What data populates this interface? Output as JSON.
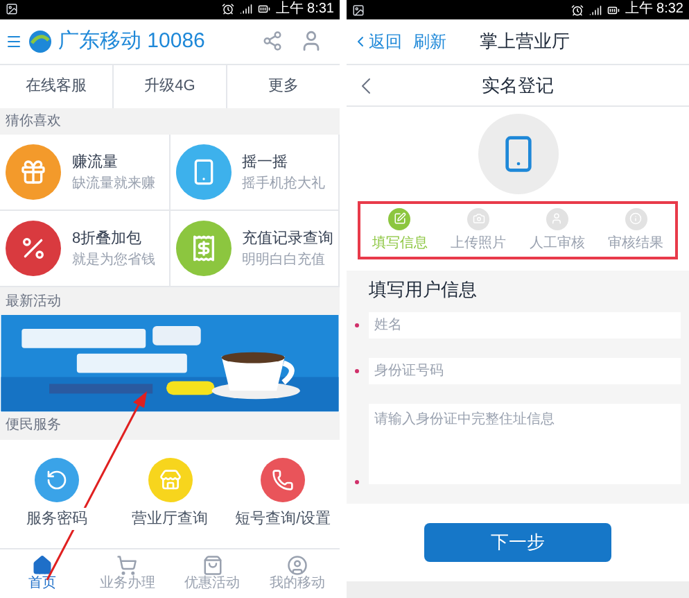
{
  "left": {
    "status_bar": {
      "time": "上午 8:31"
    },
    "app_title": "广东移动 10086",
    "quick_links": [
      "在线客服",
      "升级4G",
      "更多"
    ],
    "recommend": {
      "title": "猜你喜欢",
      "items": [
        {
          "kind": "gift",
          "title": "赚流量",
          "subtitle": "缺流量就来赚",
          "color": "#f39a2b"
        },
        {
          "kind": "shake",
          "title": "摇一摇",
          "subtitle": "摇手机抢大礼",
          "color": "#3db1ec"
        },
        {
          "kind": "discount",
          "title": "8折叠加包",
          "subtitle": "就是为您省钱",
          "color": "#d93a3f"
        },
        {
          "kind": "recharge",
          "title": "充值记录查询",
          "subtitle": "明明白白充值",
          "color": "#8cc63f"
        }
      ]
    },
    "activity": {
      "title": "最新活动"
    },
    "services": {
      "title": "便民服务",
      "items": [
        {
          "kind": "password",
          "label": "服务密码",
          "color": "#3aa3e8"
        },
        {
          "kind": "store",
          "label": "营业厅查询",
          "color": "#f7d51d"
        },
        {
          "kind": "phone",
          "label": "短号查询/设置",
          "color": "#e9545a"
        }
      ]
    },
    "bottom_nav": [
      {
        "kind": "home",
        "label": "首页",
        "selected": true
      },
      {
        "kind": "cart",
        "label": "业务办理",
        "selected": false
      },
      {
        "kind": "bag",
        "label": "优惠活动",
        "selected": false
      },
      {
        "kind": "user",
        "label": "我的移动",
        "selected": false
      }
    ]
  },
  "right": {
    "status_bar": {
      "time": "上午 8:32"
    },
    "back": "返回",
    "refresh": "刷新",
    "title": "掌上营业厅",
    "page_title": "实名登记",
    "steps": [
      {
        "kind": "edit",
        "label": "填写信息",
        "selected": true
      },
      {
        "kind": "camera",
        "label": "上传照片",
        "selected": false
      },
      {
        "kind": "user",
        "label": "人工审核",
        "selected": false
      },
      {
        "kind": "info",
        "label": "审核结果",
        "selected": false
      }
    ],
    "form_title": "填写用户信息",
    "fields": [
      {
        "kind": "input",
        "placeholder": "姓名",
        "required": true
      },
      {
        "kind": "input",
        "placeholder": "身份证号码",
        "required": true
      },
      {
        "kind": "textarea",
        "placeholder": "请输入身份证中完整住址信息",
        "required": true
      }
    ],
    "button": "下一步"
  }
}
